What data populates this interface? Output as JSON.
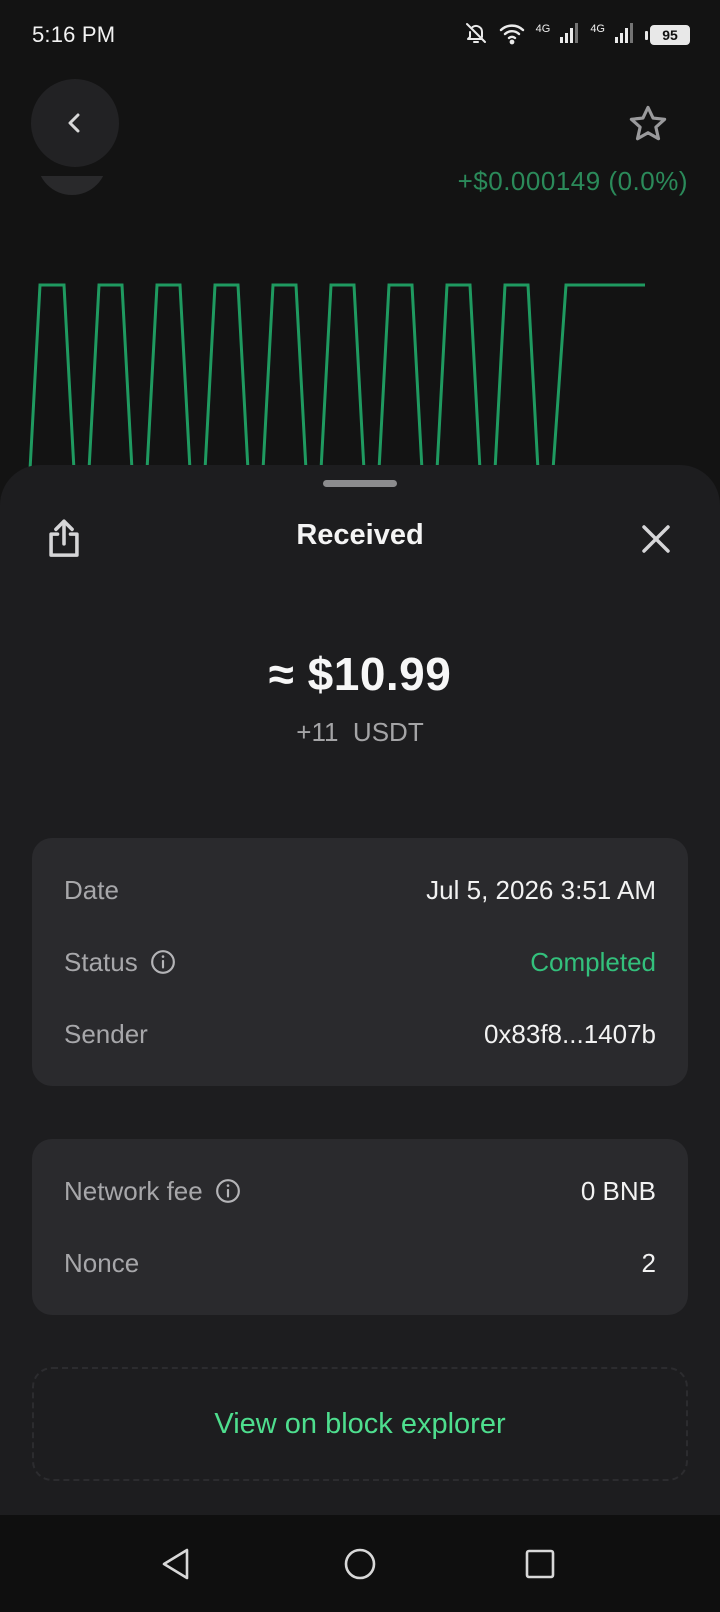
{
  "status_bar": {
    "time": "5:16 PM",
    "network_1": "4G",
    "network_2": "4G",
    "battery": "95",
    "icons": [
      "bell-off-icon",
      "wifi-icon",
      "signal-icon",
      "signal-icon",
      "battery-icon"
    ]
  },
  "background": {
    "price_change": "+$0.000149 (0.0%)",
    "chart_color": "#1f9a60",
    "icons": {
      "back": "chevron-left-icon",
      "favorite": "star-outline-icon"
    }
  },
  "sheet": {
    "title": "Received",
    "amount_fiat": "≈ $10.99",
    "amount_token": "+11  USDT",
    "details": [
      {
        "label": "Date",
        "value": "Jul 5, 2026 3:51 AM",
        "info": false
      },
      {
        "label": "Status",
        "value": "Completed",
        "info": true
      },
      {
        "label": "Sender",
        "value": "0x83f8...1407b",
        "info": false
      }
    ],
    "fees": [
      {
        "label": "Network fee",
        "value": "0 BNB",
        "info": true
      },
      {
        "label": "Nonce",
        "value": "2",
        "info": false
      }
    ],
    "explorer_label": "View on block explorer",
    "icons": {
      "share": "share-icon",
      "close": "close-icon",
      "info": "info-icon"
    }
  },
  "colors": {
    "background": "#131313",
    "sheet": "#1d1d1f",
    "card": "#2a2a2d",
    "accent_green": "#4ede8e",
    "status_green": "#33c07c"
  },
  "nav_bar": {
    "icons": [
      "back-triangle-icon",
      "home-circle-icon",
      "recents-square-icon"
    ]
  }
}
